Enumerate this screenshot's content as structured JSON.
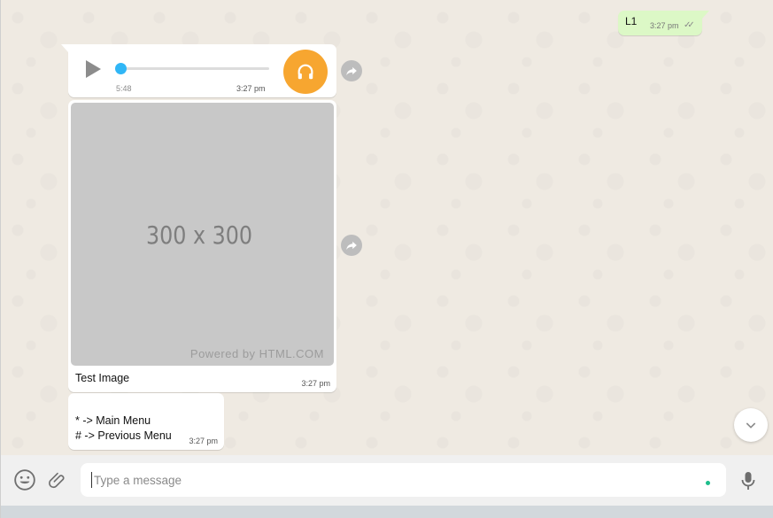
{
  "messages": {
    "outgoing": {
      "text": "L1",
      "time": "3:27 pm",
      "status_icon": "double-check-icon"
    },
    "audio": {
      "duration": "5:48",
      "time": "3:27 pm",
      "progress": 0.0,
      "avatar_icon": "headphones-icon",
      "avatar_color": "#f7a630",
      "knob_color": "#30b6f6"
    },
    "image": {
      "placeholder_size": "300 x 300",
      "powered_by": "Powered by HTML.COM",
      "caption": "Test Image",
      "time": "3:27 pm"
    },
    "menu": {
      "lines": [
        "* -> Main Menu",
        "# -> Previous Menu"
      ],
      "time": "3:27 pm"
    }
  },
  "composer": {
    "placeholder": "Type a message",
    "value": "",
    "emoji_icon": "emoji-icon",
    "attach_icon": "paperclip-icon",
    "mic_icon": "microphone-icon"
  },
  "colors": {
    "outgoing_bubble": "#dcf8c6",
    "chat_background": "#efeae2",
    "accent_green": "#1dbd8b"
  }
}
